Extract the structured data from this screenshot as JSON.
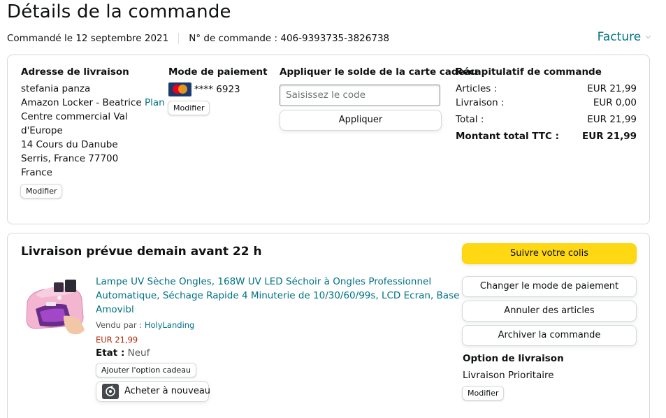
{
  "page": {
    "title": "Détails de la commande",
    "ordered_label": "Commandé le 12 septembre 2021",
    "order_number_label": "N° de commande : 406-9393735-3826738",
    "invoice_label": "Facture"
  },
  "summary_box": {
    "shipping": {
      "heading": "Adresse de livraison",
      "name": "stefania panza",
      "locker_prefix": "Amazon Locker - Beatrice",
      "plan_link": "Plan",
      "line3": "Centre commercial Val",
      "line4": "d'Europe",
      "line5": "14 Cours du Danube",
      "line6": "Serris, France 77700",
      "line7": "France",
      "modify_label": "Modifier"
    },
    "payment": {
      "heading": "Mode de paiement",
      "card_brand": "MasterCard",
      "card_masked": "**** 6923",
      "modify_label": "Modifier"
    },
    "gift_card": {
      "heading": "Appliquer le solde de la carte cadeau",
      "placeholder": "Saisissez le code",
      "apply_label": "Appliquer"
    },
    "order_summary": {
      "heading": "Récapitulatif de commande",
      "rows": [
        {
          "label": "Articles :",
          "value": "EUR 21,99"
        },
        {
          "label": "Livraison :",
          "value": "EUR 0,00"
        },
        {
          "label": "Total :",
          "value": "EUR 21,99"
        }
      ],
      "grand_total_label": "Montant total TTC :",
      "grand_total_value": "EUR 21,99"
    }
  },
  "shipment": {
    "heading": "Livraison prévue demain avant 22 h",
    "item": {
      "title_line1": "Lampe UV Sèche Ongles, 168W UV LED Séchoir à Ongles Professionnel",
      "title_line2": "Automatique, Séchage Rapide 4 Minuterie de 10/30/60/99s, LCD Ecran, Base",
      "title_line3": "Amovibl",
      "sold_by_label": "Vendu par :",
      "seller": "HolyLanding",
      "price": "EUR 21,99",
      "condition_label": "Etat :",
      "condition": "Neuf",
      "gift_option_label": "Ajouter l'option cadeau",
      "buy_again_label": "Acheter à nouveau"
    },
    "actions": {
      "track": "Suivre votre colis",
      "change_payment": "Changer le mode de paiement",
      "cancel": "Annuler des articles",
      "archive": "Archiver la commande"
    },
    "delivery_option": {
      "heading": "Option de livraison",
      "value": "Livraison Prioritaire",
      "modify_label": "Modifier"
    }
  },
  "colors": {
    "link": "#007185",
    "price": "#b12704",
    "primary_button": "#ffd814",
    "border": "#d5d9d9"
  }
}
